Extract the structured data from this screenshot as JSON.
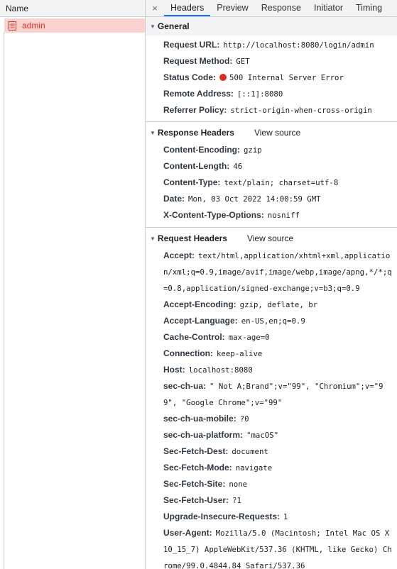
{
  "left": {
    "header": "Name",
    "request_name": "admin",
    "request_color": "#d93025",
    "request_bg": "#fad2cf",
    "icon": "document-icon"
  },
  "tabs": {
    "close": "×",
    "items": [
      "Headers",
      "Preview",
      "Response",
      "Initiator",
      "Timing"
    ],
    "active": "Headers"
  },
  "view_source": "View source",
  "general": {
    "title": "General",
    "rows": [
      {
        "key": "Request URL:",
        "value": "http://localhost:8080/login/admin"
      },
      {
        "key": "Request Method:",
        "value": "GET"
      },
      {
        "key": "Status Code:",
        "value": "500 Internal Server Error"
      },
      {
        "key": "Remote Address:",
        "value": "[::1]:8080"
      },
      {
        "key": "Referrer Policy:",
        "value": "strict-origin-when-cross-origin"
      }
    ]
  },
  "response_headers": {
    "title": "Response Headers",
    "rows": [
      {
        "key": "Content-Encoding:",
        "value": "gzip"
      },
      {
        "key": "Content-Length:",
        "value": "46"
      },
      {
        "key": "Content-Type:",
        "value": "text/plain; charset=utf-8"
      },
      {
        "key": "Date:",
        "value": "Mon, 03 Oct 2022 14:00:59 GMT"
      },
      {
        "key": "X-Content-Type-Options:",
        "value": "nosniff"
      }
    ]
  },
  "request_headers": {
    "title": "Request Headers",
    "rows": [
      {
        "key": "Accept:",
        "value": "text/html,application/xhtml+xml,application/xml;q=0.9,image/avif,image/webp,image/apng,*/*;q=0.8,application/signed-exchange;v=b3;q=0.9"
      },
      {
        "key": "Accept-Encoding:",
        "value": "gzip, deflate, br"
      },
      {
        "key": "Accept-Language:",
        "value": "en-US,en;q=0.9"
      },
      {
        "key": "Cache-Control:",
        "value": "max-age=0"
      },
      {
        "key": "Connection:",
        "value": "keep-alive"
      },
      {
        "key": "Host:",
        "value": "localhost:8080"
      },
      {
        "key": "sec-ch-ua:",
        "value": "\" Not A;Brand\";v=\"99\", \"Chromium\";v=\"99\", \"Google Chrome\";v=\"99\""
      },
      {
        "key": "sec-ch-ua-mobile:",
        "value": "?0"
      },
      {
        "key": "sec-ch-ua-platform:",
        "value": "\"macOS\""
      },
      {
        "key": "Sec-Fetch-Dest:",
        "value": "document"
      },
      {
        "key": "Sec-Fetch-Mode:",
        "value": "navigate"
      },
      {
        "key": "Sec-Fetch-Site:",
        "value": "none"
      },
      {
        "key": "Sec-Fetch-User:",
        "value": "?1"
      },
      {
        "key": "Upgrade-Insecure-Requests:",
        "value": "1"
      },
      {
        "key": "User-Agent:",
        "value": "Mozilla/5.0 (Macintosh; Intel Mac OS X 10_15_7) AppleWebKit/537.36 (KHTML, like Gecko) Chrome/99.0.4844.84 Safari/537.36"
      }
    ]
  }
}
